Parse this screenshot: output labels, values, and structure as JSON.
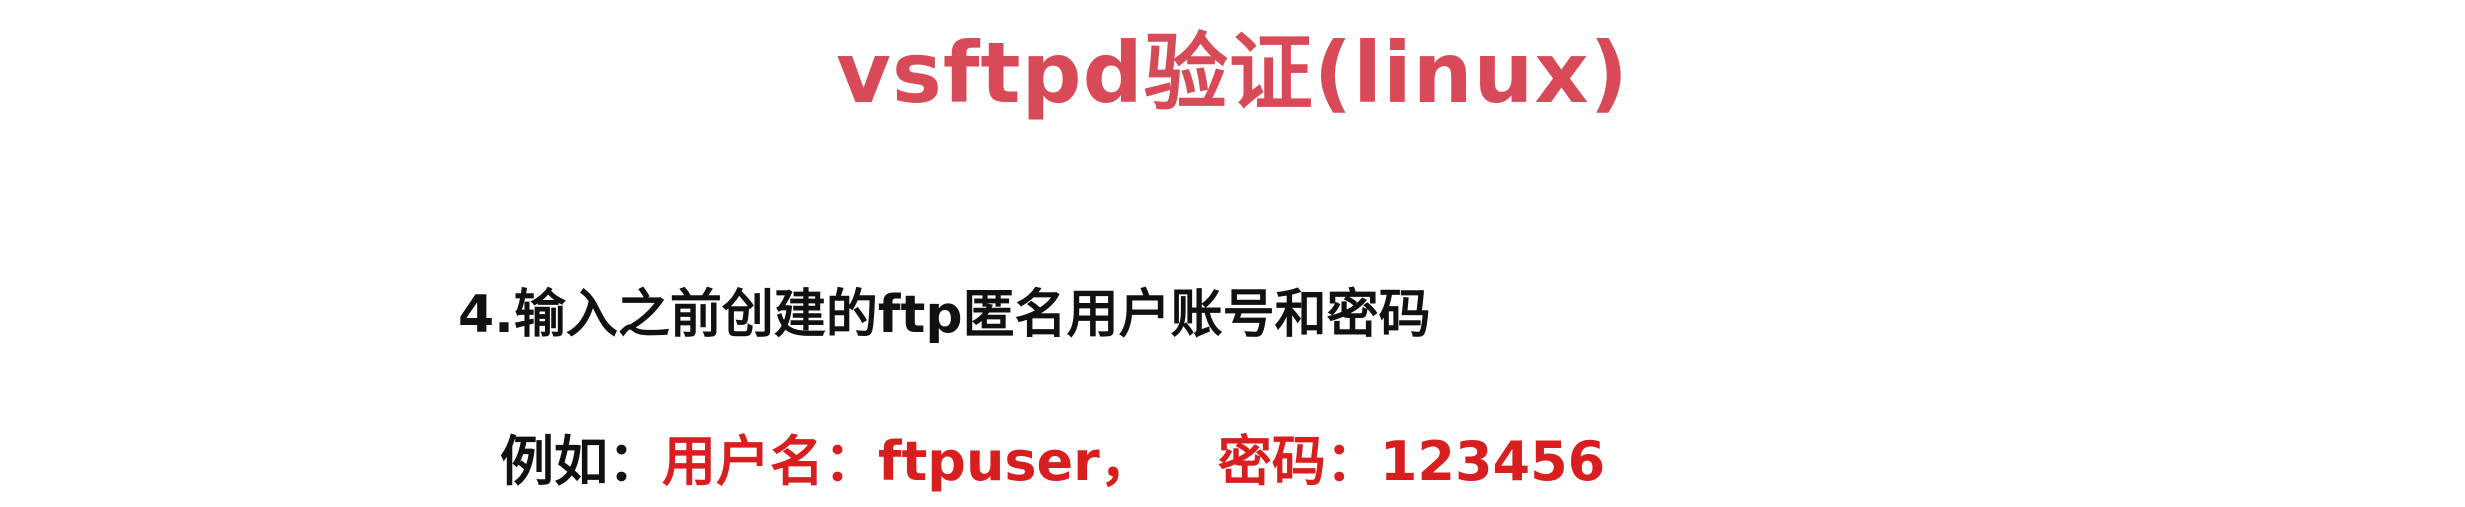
{
  "colors": {
    "title": "#d94a58",
    "text": "#111111",
    "highlight": "#d81e1e",
    "background": "#ffffff"
  },
  "slide": {
    "title": "vsftpd验证(linux)",
    "step": "4.输入之前创建的ftp匿名用户账号和密码",
    "example": {
      "prefix": "例如：",
      "username_label": "用户名：",
      "username_value": "ftpuser",
      "separator": " ，",
      "password_label": "密码：",
      "password_value": "123456"
    }
  }
}
